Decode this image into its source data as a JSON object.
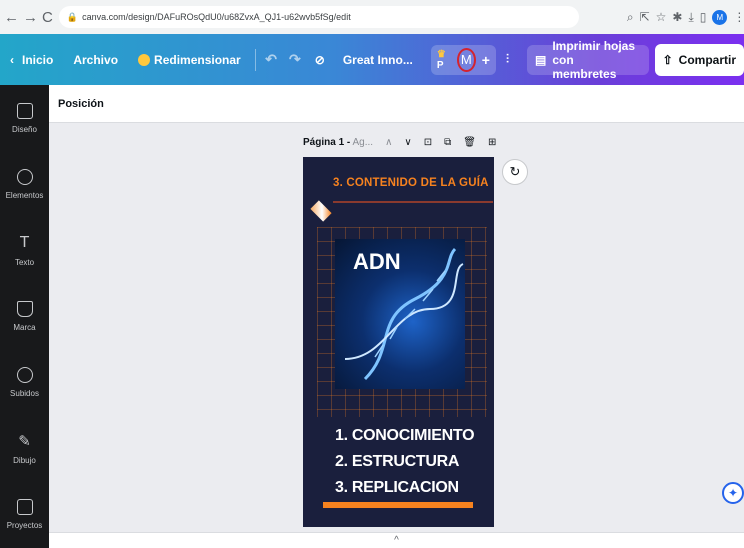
{
  "browser": {
    "url": "canva.com/design/DAFuROsQdU0/u68ZvxA_QJ1-u62wvb5fSg/edit",
    "profile_initial": "M"
  },
  "topbar": {
    "home_label": "Inicio",
    "file_label": "Archivo",
    "resize_label": "Redimensionar",
    "design_title": "Great Inno...",
    "pro_short": "P",
    "user_initial": "M",
    "print_label": "Imprimir hojas con membretes",
    "share_label": "Compartir"
  },
  "sidebar": {
    "items": [
      {
        "label": "Diseño",
        "icon": "layout-icon"
      },
      {
        "label": "Elementos",
        "icon": "shapes-icon"
      },
      {
        "label": "Texto",
        "icon": "text-icon"
      },
      {
        "label": "Marca",
        "icon": "brand-icon"
      },
      {
        "label": "Subidos",
        "icon": "upload-icon"
      },
      {
        "label": "Dibujo",
        "icon": "draw-icon"
      },
      {
        "label": "Proyectos",
        "icon": "folder-icon"
      }
    ]
  },
  "editor": {
    "position_label": "Posición",
    "page_label": "Página 1 -",
    "page_subtitle": "Ag..."
  },
  "design": {
    "heading": "3. CONTENIDO DE LA GUÍA",
    "image_caption": "ADN",
    "list": [
      "1. CONOCIMIENTO",
      "2. ESTRUCTURA",
      "3. REPLICACION"
    ],
    "accent_color": "#f6821f",
    "background_color": "#1a1f3d"
  }
}
